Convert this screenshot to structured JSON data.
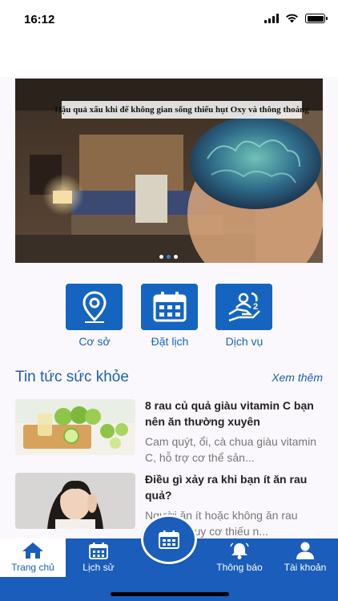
{
  "status": {
    "time": "16:12"
  },
  "banner": {
    "caption": "Hậu quả xấu khi để không gian sống thiếu hụt Oxy và thông thoáng",
    "slides": 3,
    "active_slide": 2
  },
  "quick_actions": [
    {
      "label": "Cơ sở",
      "icon": "location-pin-icon"
    },
    {
      "label": "Đặt lịch",
      "icon": "calendar-icon"
    },
    {
      "label": "Dịch vụ",
      "icon": "service-hand-icon"
    }
  ],
  "news": {
    "title": "Tin tức sức khỏe",
    "see_more": "Xem thêm",
    "items": [
      {
        "title": "8 rau củ quả giàu vitamin C bạn nên ăn thường xuyên",
        "summary": "Cam quýt, ổi, cà chua giàu vitamin C, hỗ trợ cơ thể sản..."
      },
      {
        "title": "Điều gì xảy ra khi bạn ít ăn rau quả?",
        "summary": "Người ăn ít hoặc không ăn rau quả có nguy cơ thiếu n..."
      }
    ]
  },
  "tabs": [
    {
      "label": "Trang chủ",
      "icon": "home-icon",
      "active": true
    },
    {
      "label": "Lịch sử",
      "icon": "calendar-history-icon",
      "active": false
    },
    {
      "label": "Thông báo",
      "icon": "bell-icon",
      "active": false
    },
    {
      "label": "Tài khoản",
      "icon": "user-icon",
      "active": false
    }
  ],
  "colors": {
    "primary": "#1565c0",
    "tab_bar": "#1a5dbb",
    "accent_text": "#1e5fb4"
  }
}
